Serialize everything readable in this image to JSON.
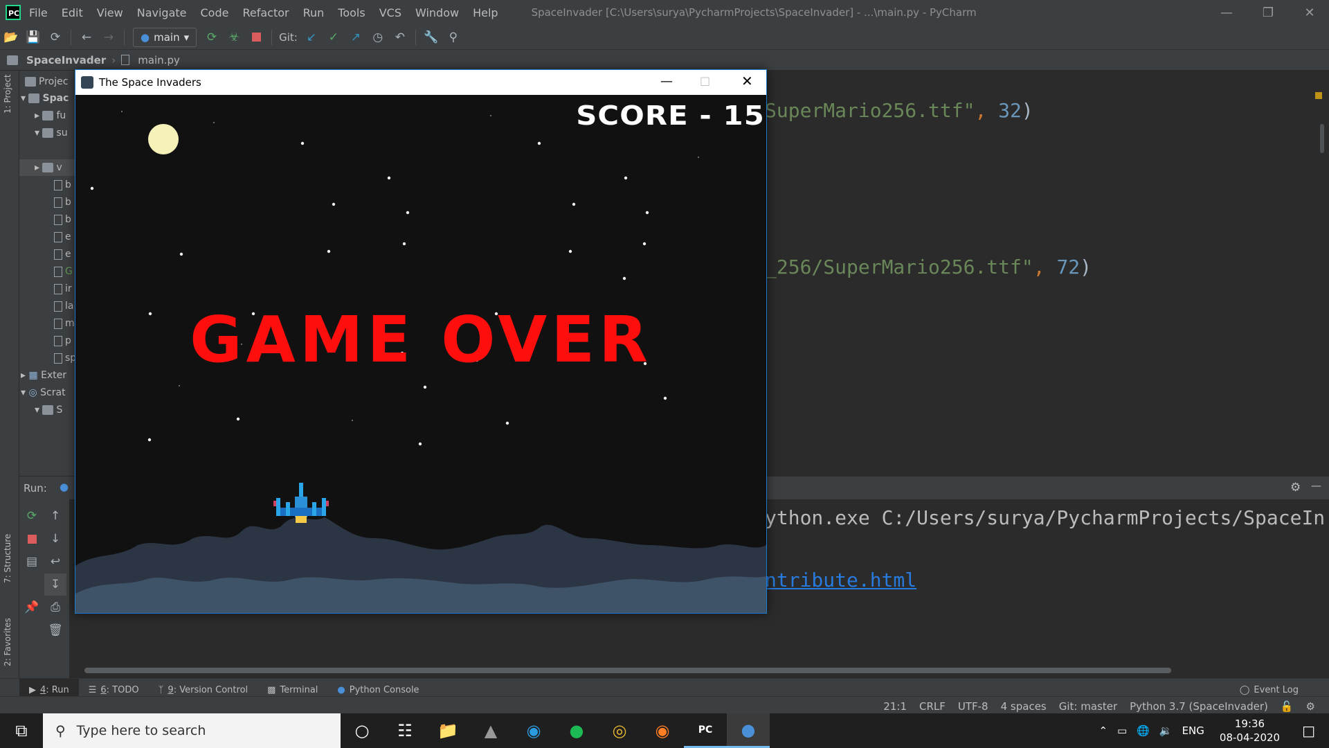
{
  "menubar": {
    "items": [
      "File",
      "Edit",
      "View",
      "Navigate",
      "Code",
      "Refactor",
      "Run",
      "Tools",
      "VCS",
      "Window",
      "Help"
    ],
    "window_title": "SpaceInvader [C:\\Users\\surya\\PycharmProjects\\SpaceInvader] - ...\\main.py - PyCharm",
    "logo_text": "PC"
  },
  "toolbar": {
    "run_config": "main",
    "git_label": "Git:"
  },
  "breadcrumb": {
    "project": "SpaceInvader",
    "file": "main.py"
  },
  "sidebar": {
    "project_tab": "1: Project",
    "structure_tab": "7: Structure",
    "favorites_tab": "2: Favorites"
  },
  "project_panel": {
    "title": "Projec",
    "rows": [
      "Spac",
      "fu",
      "su",
      "",
      "v",
      "b",
      "b",
      "b",
      "e",
      "e",
      "G",
      "ir",
      "la",
      "m",
      "p",
      "sp",
      "Exter",
      "Scrat",
      "S",
      ""
    ]
  },
  "editor": {
    "line1": {
      "str": "SuperMario256.ttf\"",
      "sep": ", ",
      "num": "32",
      "close": ")"
    },
    "line2": {
      "str": "_256/SuperMario256.ttf\"",
      "sep": ", ",
      "num": "72",
      "close": ")"
    }
  },
  "run_panel": {
    "label": "Run:",
    "console_line1": "ython.exe C:/Users/surya/PycharmProjects/SpaceIn",
    "console_link": "ntribute.html"
  },
  "game": {
    "title": "The Space Invaders",
    "score_text": "SCORE - 15",
    "gameover_text": "GAME OVER"
  },
  "bottom_tabs": [
    {
      "num": "4",
      "label": ": Run"
    },
    {
      "num": "6",
      "label": ": TODO"
    },
    {
      "num": "9",
      "label": ": Version Control"
    },
    {
      "num": "",
      "label": "Terminal"
    },
    {
      "num": "",
      "label": "Python Console"
    }
  ],
  "event_log": "Event Log",
  "status": {
    "position": "21:1",
    "line_sep": "CRLF",
    "encoding": "UTF-8",
    "indent": "4 spaces",
    "git": "Git: master",
    "interpreter": "Python 3.7 (SpaceInvader)"
  },
  "taskbar": {
    "search_placeholder": "Type here to search",
    "lang": "ENG",
    "time": "19:36",
    "date": "08-04-2020"
  },
  "colors": {
    "gameover": "#ff0e0e",
    "accent": "#21d789",
    "link": "#287bde"
  }
}
